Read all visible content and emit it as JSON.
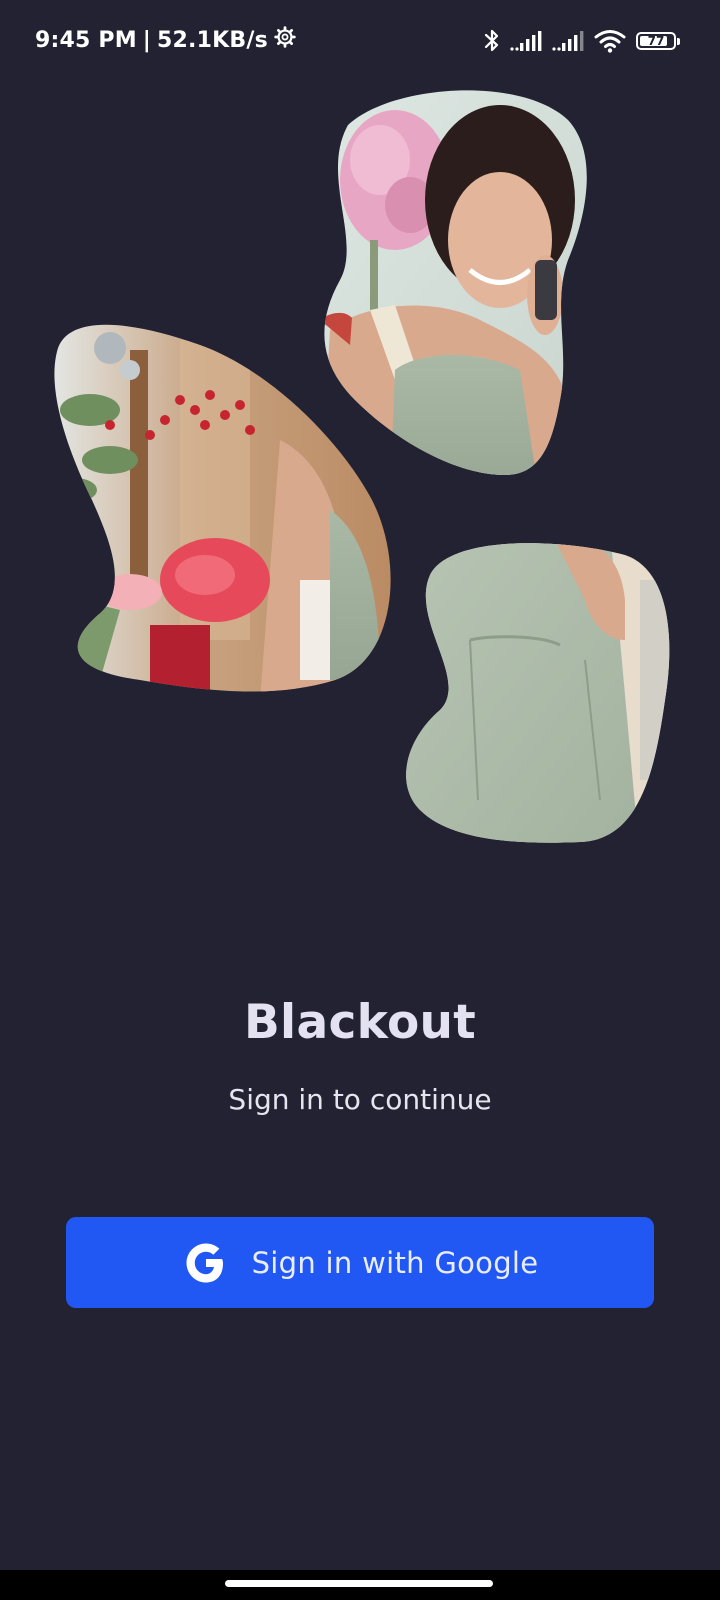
{
  "status_bar": {
    "time": "9:45 PM",
    "separator": "|",
    "network_speed": "52.1KB/s",
    "battery_level": "77",
    "icons": [
      "settings-gear-icon",
      "bluetooth-icon",
      "signal-icon",
      "signal-icon",
      "wifi-icon",
      "battery-icon"
    ]
  },
  "hero": {
    "images": [
      "florist-woman-on-phone-photo",
      "flowers-shop-photo",
      "apron-photo"
    ]
  },
  "app": {
    "title": "Blackout",
    "subtitle": "Sign in to continue"
  },
  "google_button": {
    "label": "Sign in with Google",
    "icon": "google-g-icon",
    "color": "#2158f3"
  },
  "colors": {
    "background": "#232232",
    "accent": "#2158f3",
    "title": "#e4e2f0"
  }
}
